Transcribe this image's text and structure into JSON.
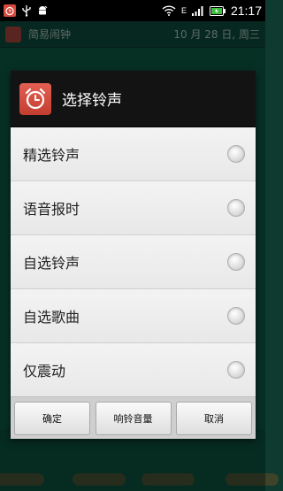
{
  "status_bar": {
    "network_label": "E",
    "time": "21:17"
  },
  "background_app": {
    "title": "简易闹钟",
    "date": "10 月 28 日, 周三"
  },
  "dialog": {
    "title": "选择铃声",
    "options": [
      {
        "label": "精选铃声",
        "selected": false
      },
      {
        "label": "语音报时",
        "selected": false
      },
      {
        "label": "自选铃声",
        "selected": false
      },
      {
        "label": "自选歌曲",
        "selected": false
      },
      {
        "label": "仅震动",
        "selected": false
      }
    ],
    "buttons": {
      "confirm": "确定",
      "volume": "响铃音量",
      "cancel": "取消"
    }
  },
  "colors": {
    "accent_red": "#d84a3e",
    "background_green": "#0c4a3a",
    "dialog_header": "#131313"
  }
}
